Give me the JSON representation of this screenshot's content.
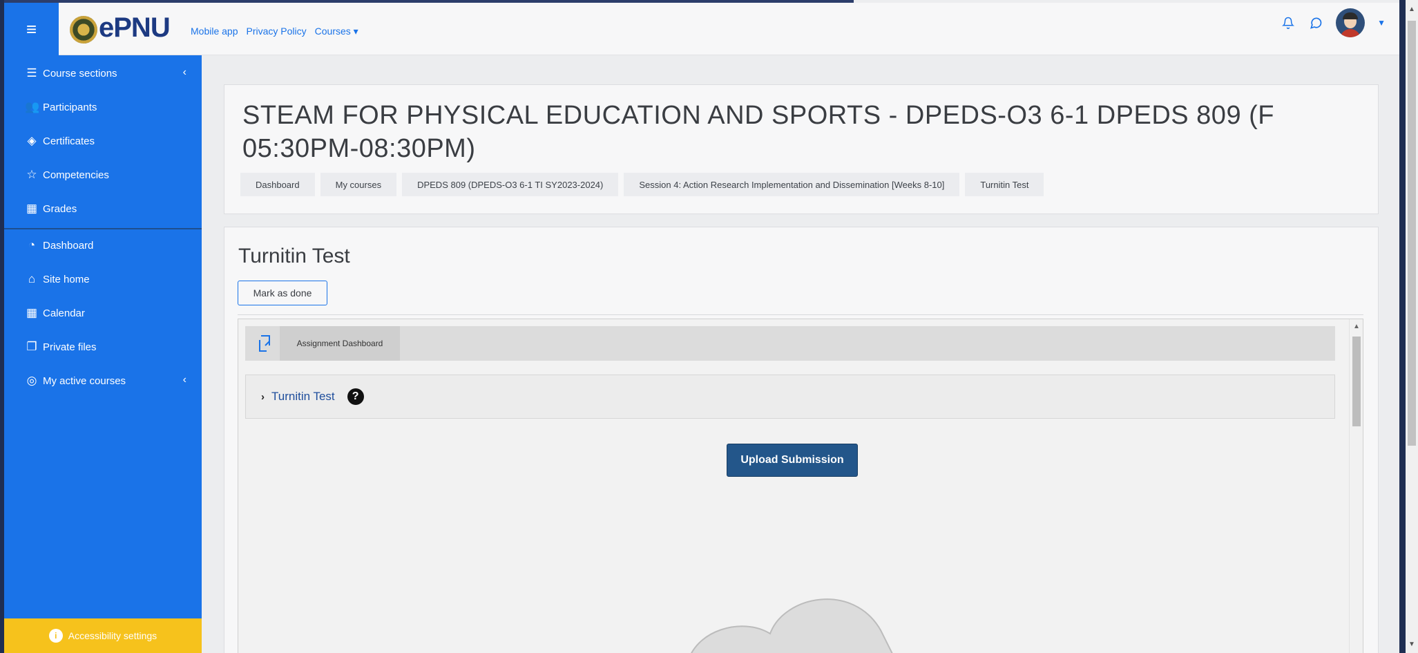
{
  "navbar": {
    "logo_text": "ePNU",
    "links": [
      "Mobile app",
      "Privacy Policy",
      "Courses"
    ],
    "courses_caret": "▾",
    "icons": [
      "bell-icon",
      "chat-icon"
    ]
  },
  "sidebar": {
    "items": [
      {
        "label": "Course sections",
        "icon": "list-icon",
        "chevron": "‹"
      },
      {
        "label": "Participants",
        "icon": "participants-icon"
      },
      {
        "label": "Certificates",
        "icon": "certificates-icon"
      },
      {
        "label": "Competencies",
        "icon": "star-icon"
      },
      {
        "label": "Grades",
        "icon": "grades-icon"
      },
      {
        "label": "Dashboard",
        "icon": "dashboard-icon"
      },
      {
        "label": "Site home",
        "icon": "home-icon"
      },
      {
        "label": "Calendar",
        "icon": "calendar-icon"
      },
      {
        "label": "Private files",
        "icon": "files-icon"
      },
      {
        "label": "My active courses",
        "icon": "courses-icon",
        "chevron": "‹"
      }
    ],
    "accessibility": "Accessibility settings"
  },
  "header": {
    "title": "STEAM FOR PHYSICAL EDUCATION AND SPORTS - DPEDS-O3 6-1 DPEDS 809 (F 05:30PM-08:30PM)",
    "breadcrumb": [
      "Dashboard",
      "My courses",
      "DPEDS 809 (DPEDS-O3 6-1 TI SY2023-2024)",
      "Session 4: Action Research Implementation and Dissemination [Weeks 8-10]",
      "Turnitin Test"
    ]
  },
  "content": {
    "page_title": "Turnitin Test",
    "mark_done": "Mark as done",
    "tii": {
      "tab": "Assignment Dashboard",
      "panel_title": "Turnitin Test",
      "help": "?",
      "upload": "Upload Submission"
    }
  },
  "colors": {
    "accent": "#1a73e8",
    "sidebar_bg": "#1a73e8",
    "accessibility_bg": "#f6c21c",
    "upload_btn": "#23568a"
  }
}
